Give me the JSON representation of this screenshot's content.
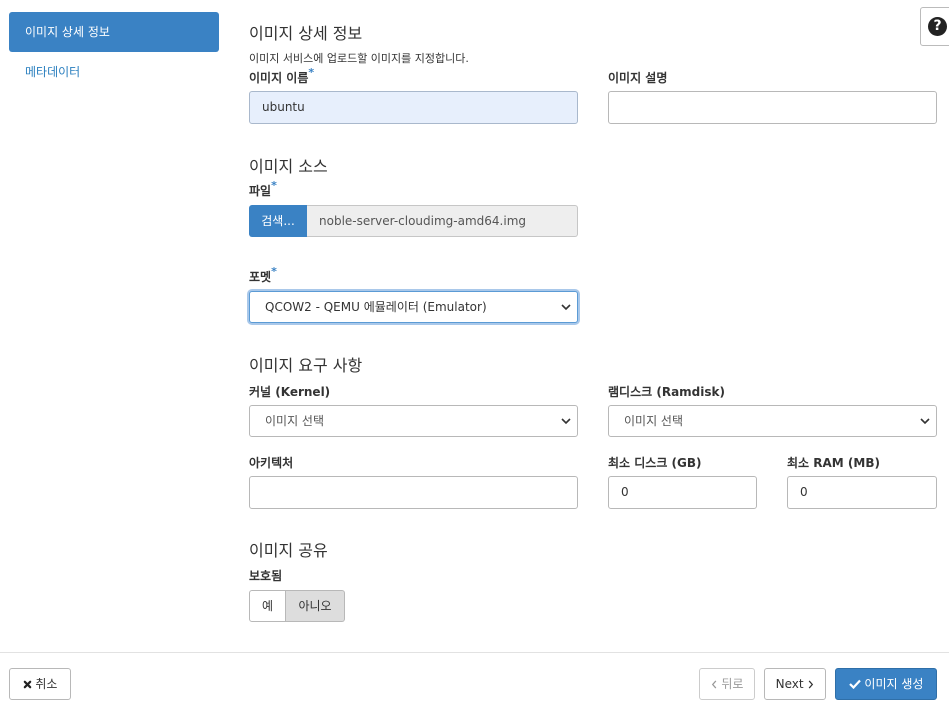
{
  "sidebar": {
    "items": [
      {
        "label": "이미지 상세 정보",
        "active": true
      },
      {
        "label": "메타데이터",
        "active": false
      }
    ]
  },
  "help": {
    "icon": "question-icon",
    "glyph": "?"
  },
  "details": {
    "title": "이미지 상세 정보",
    "description": "이미지 서비스에 업로드할 이미지를 지정합니다.",
    "name_label": "이미지 이름",
    "name_value": "ubuntu",
    "desc_label": "이미지 설명",
    "desc_value": ""
  },
  "source": {
    "title": "이미지 소스",
    "file_label": "파일",
    "browse_label": "검색...",
    "file_name": "noble-server-cloudimg-amd64.img",
    "format_label": "포멧",
    "format_value": "QCOW2 - QEMU 에뮬레이터 (Emulator)"
  },
  "requirements": {
    "title": "이미지 요구 사항",
    "kernel_label": "커널 (Kernel)",
    "kernel_value": "이미지 선택",
    "ramdisk_label": "램디스크 (Ramdisk)",
    "ramdisk_value": "이미지 선택",
    "arch_label": "아키텍처",
    "arch_value": "",
    "min_disk_label": "최소 디스크 (GB)",
    "min_disk_value": "0",
    "min_ram_label": "최소 RAM (MB)",
    "min_ram_value": "0"
  },
  "sharing": {
    "title": "이미지 공유",
    "protected_label": "보호됨",
    "yes_label": "예",
    "no_label": "아니오",
    "selected": "아니오"
  },
  "required_mark": "*",
  "footer": {
    "cancel_label": "취소",
    "back_label": "뒤로",
    "next_label": "Next",
    "create_label": "이미지 생성"
  },
  "colors": {
    "accent": "#3a82c4",
    "filled_input": "#e7effc"
  }
}
